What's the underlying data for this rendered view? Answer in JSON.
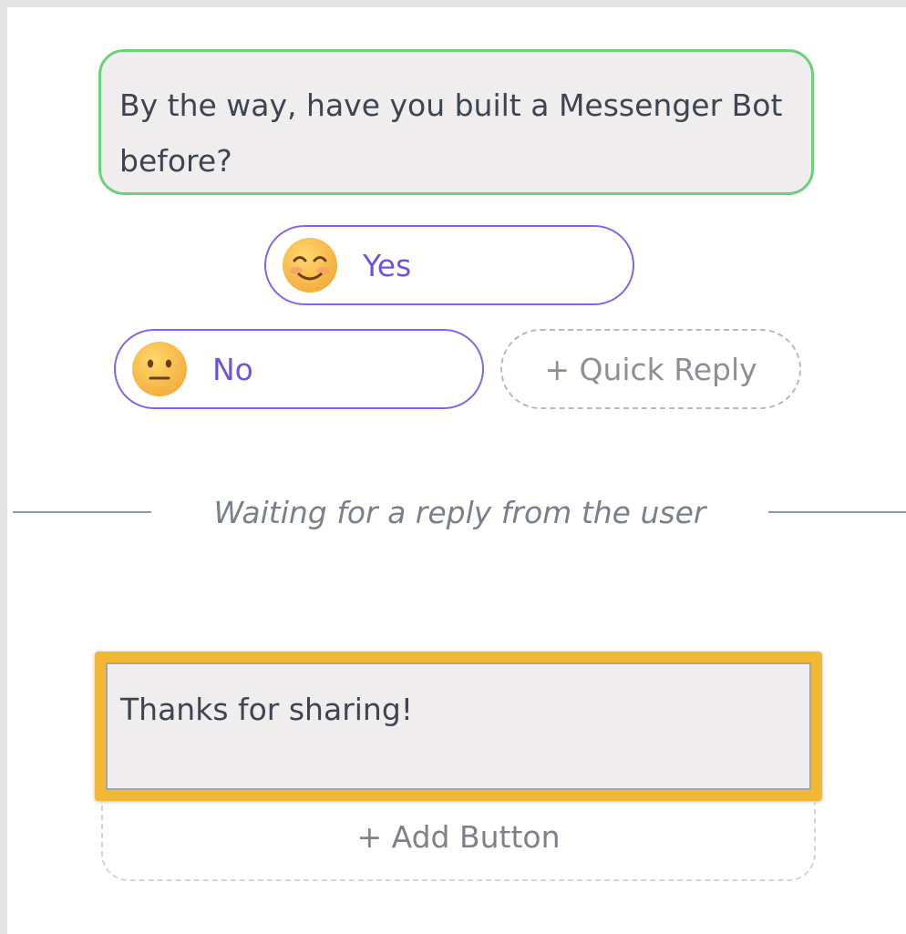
{
  "message": {
    "text": "By the way, have you built a Messenger Bot before?"
  },
  "quick_replies": [
    {
      "label": "Yes",
      "icon": "smiling-face-icon"
    },
    {
      "label": "No",
      "icon": "neutral-face-icon"
    }
  ],
  "add_quick_reply_label": "+ Quick Reply",
  "waiting_text": "Waiting for a reply from the user",
  "text_card": {
    "text": "Thanks for sharing!"
  },
  "add_button_label": "+ Add Button",
  "colors": {
    "bubble_border": "#6ccf79",
    "quick_reply_accent": "#6a55e2",
    "selection_highlight": "#f2b733"
  }
}
